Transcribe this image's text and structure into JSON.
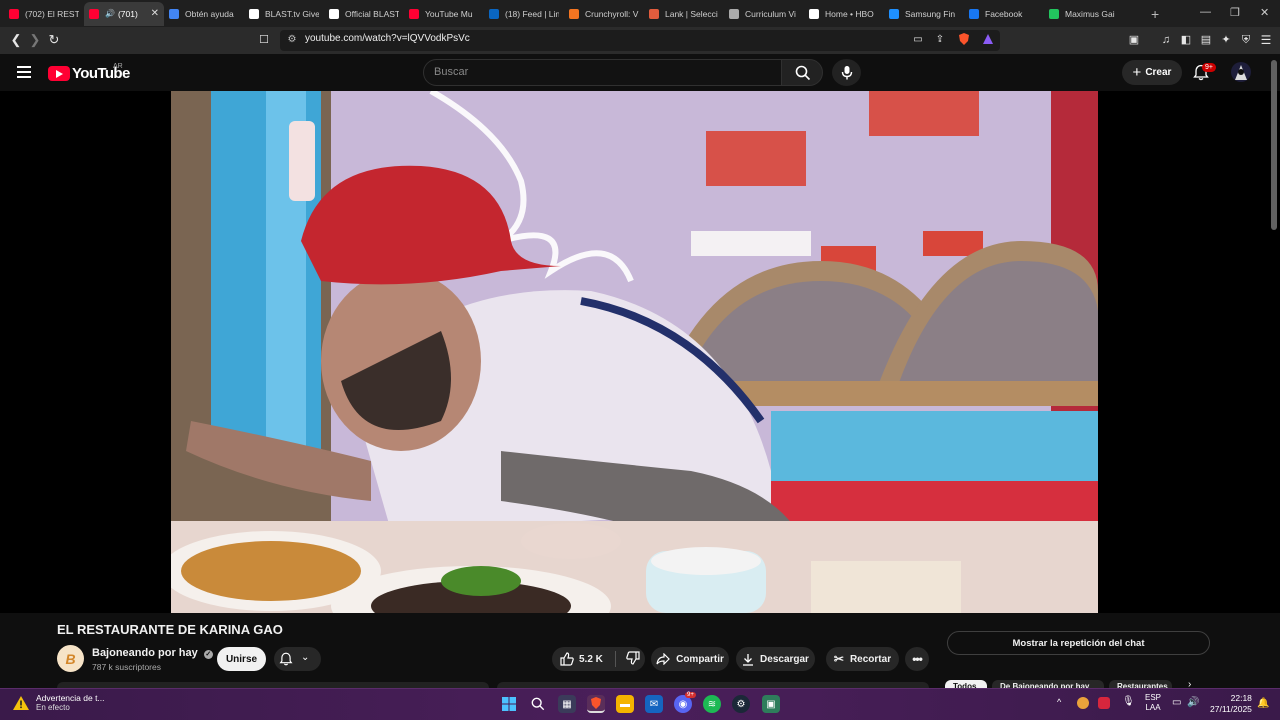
{
  "browser": {
    "tabs": [
      {
        "label": "(702) El RESTA",
        "color": "#ff0033",
        "icon": "youtube-icon"
      },
      {
        "label": "(701)",
        "color": "#ff0033",
        "icon": "youtube-icon",
        "active": true,
        "audio": true
      },
      {
        "label": "Obtén ayuda",
        "color": "#4285f4",
        "icon": "google-icon"
      },
      {
        "label": "BLAST.tv Give",
        "color": "#ffffff",
        "icon": "blast-icon"
      },
      {
        "label": "Official BLAST",
        "color": "#ffffff",
        "icon": "blast-icon"
      },
      {
        "label": "YouTube Mu",
        "color": "#ff0033",
        "icon": "youtube-music-icon"
      },
      {
        "label": "(18) Feed | Lin",
        "color": "#0a66c2",
        "icon": "linkedin-icon"
      },
      {
        "label": "Crunchyroll: V",
        "color": "#f47521",
        "icon": "crunchyroll-icon"
      },
      {
        "label": "Lank | Selecci",
        "color": "#e25c3d",
        "icon": "lank-icon"
      },
      {
        "label": "Curriculum Vi",
        "color": "#aaaaaa",
        "icon": "globe-icon"
      },
      {
        "label": "Home • HBO",
        "color": "#ffffff",
        "icon": "hbo-icon"
      },
      {
        "label": "Samsung Fin",
        "color": "#1e90ff",
        "icon": "samsung-icon"
      },
      {
        "label": "Facebook",
        "color": "#1877f2",
        "icon": "facebook-icon"
      },
      {
        "label": "Maximus Gai",
        "color": "#22c55e",
        "icon": "maximus-icon"
      }
    ],
    "url": "youtube.com/watch?v=lQVVodkPsVc"
  },
  "youtube": {
    "logo_text": "YouTube",
    "country": "AR",
    "search_placeholder": "Buscar",
    "create_label": "Crear",
    "notifications": "9+"
  },
  "video": {
    "title": "EL RESTAURANTE DE KARINA GAO",
    "channel": "Bajoneando por hay",
    "avatar_letter": "B",
    "subscribers": "787 k suscriptores",
    "join_label": "Unirse",
    "likes": "5.2 K",
    "share_label": "Compartir",
    "download_label": "Descargar",
    "clip_label": "Recortar",
    "chat_replay_label": "Mostrar la repetición del chat",
    "chips": [
      "Todos",
      "De Bajoneando por hay",
      "Restaurantes"
    ]
  },
  "taskbar": {
    "warning_title": "Advertencia de t...",
    "warning_sub": "En efecto",
    "lang_top": "ESP",
    "lang_bottom": "LAA",
    "time": "22:18",
    "date": "27/11/2025",
    "discord_badge": "9+"
  },
  "colors": {
    "youtube_red": "#ff0033",
    "taskbar": "#4a1f5a"
  }
}
